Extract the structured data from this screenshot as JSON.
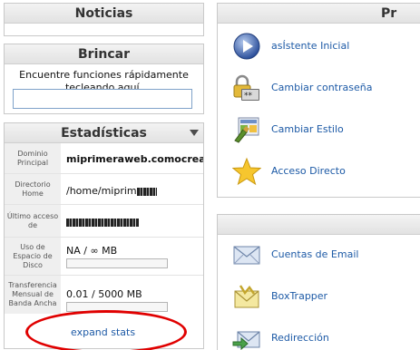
{
  "left": {
    "noticias": {
      "title": "Noticias"
    },
    "brincar": {
      "title": "Brincar",
      "description": "Encuentre funciones rápidamente tecleando aquí.",
      "input_value": ""
    },
    "estadisticas": {
      "title": "Estadísticas",
      "rows": [
        {
          "label": "Dominio Principal",
          "value": "miprimeraweb.comocreart"
        },
        {
          "label": "Directorio Home",
          "value": "/home/miprim"
        },
        {
          "label": "Último acceso de",
          "value": ""
        },
        {
          "label": "Uso de Espacio de Disco",
          "value": "NA / ∞ MB"
        },
        {
          "label": "Transferencia Mensual de Banda Ancha",
          "value": "0.01 / 5000 MB"
        }
      ],
      "disk_usage_fraction": 0,
      "bandwidth_fraction": 0,
      "expand_label": "expand stats"
    }
  },
  "right": {
    "preferences": {
      "title": "Pr",
      "items": [
        {
          "label": "asÍstente Inicial",
          "icon": "play-icon"
        },
        {
          "label": "Cambiar contraseña",
          "icon": "lock-password-icon"
        },
        {
          "label": "Cambiar Estilo",
          "icon": "style-icon"
        },
        {
          "label": "Acceso Directo",
          "icon": "star-icon"
        }
      ]
    },
    "mail": {
      "items": [
        {
          "label": "Cuentas de Email",
          "icon": "envelope-icon"
        },
        {
          "label": "BoxTrapper",
          "icon": "boxtrapper-icon"
        },
        {
          "label": "Redirección",
          "icon": "forwarder-icon"
        }
      ]
    }
  },
  "colors": {
    "link": "#1d5aa6",
    "annotation": "#e00000",
    "bar": "#3d7ac4"
  }
}
